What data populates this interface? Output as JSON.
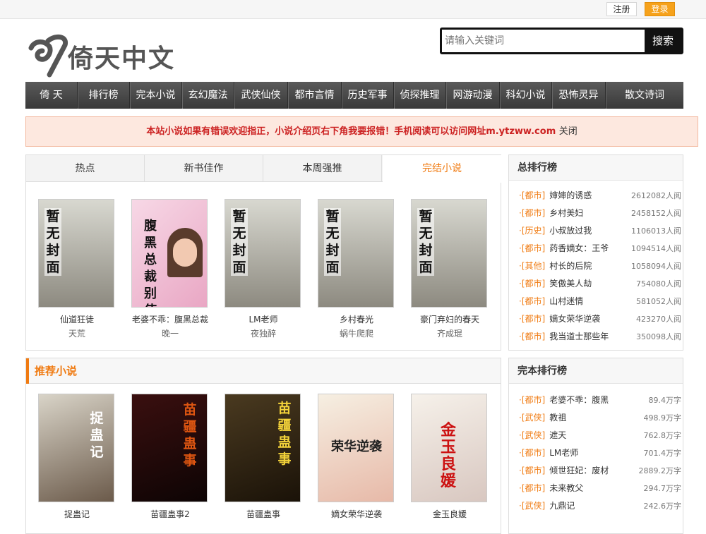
{
  "topbar": {
    "register": "注册",
    "login": "登录"
  },
  "logo": {
    "text": "倚天中文"
  },
  "search": {
    "placeholder": "请输入关键词",
    "button": "搜索"
  },
  "nav": [
    "倚 天",
    "排行榜",
    "完本小说",
    "玄幻魔法",
    "武侠仙侠",
    "都市言情",
    "历史军事",
    "侦探推理",
    "网游动漫",
    "科幻小说",
    "恐怖灵异",
    "散文诗词"
  ],
  "notice": {
    "text": "本站小说如果有错误欢迎指正，小说介绍页右下角我要报错！手机阅读可以访问网址m.ytzww.com",
    "close": "关闭"
  },
  "tabs": [
    "热点",
    "新书佳作",
    "本周强推",
    "完结小说"
  ],
  "featured": [
    {
      "title": "仙道狂徒",
      "author": "天荒",
      "cover": "暂无封面"
    },
    {
      "title": "老婆不乖：腹黑总裁",
      "author": "晚一",
      "cover": "腹黑总裁别使坏"
    },
    {
      "title": "LM老师",
      "author": "夜独醉",
      "cover": "暂无封面"
    },
    {
      "title": "乡村春光",
      "author": "蜗牛爬爬",
      "cover": "暂无封面"
    },
    {
      "title": "豪门弃妇的春天",
      "author": "齐成琨",
      "cover": "暂无封面"
    }
  ],
  "recommend": {
    "heading": "推荐小说",
    "books": [
      {
        "title": "捉蛊记",
        "cover": "捉蛊记"
      },
      {
        "title": "苗疆蛊事2",
        "cover": "苗疆蛊事"
      },
      {
        "title": "苗疆蛊事",
        "cover": "苗疆蛊事"
      },
      {
        "title": "嫡女荣华逆袭",
        "cover": "荣华逆袭"
      },
      {
        "title": "金玉良媛",
        "cover": "金玉良媛"
      }
    ]
  },
  "rank_total": {
    "heading": "总排行榜",
    "rows": [
      {
        "cat": "[都市]",
        "name": "婶婶的诱惑",
        "count": "2612082人阅"
      },
      {
        "cat": "[都市]",
        "name": "乡村美妇",
        "count": "2458152人阅"
      },
      {
        "cat": "[历史]",
        "name": "小叔放过我",
        "count": "1106013人阅"
      },
      {
        "cat": "[都市]",
        "name": "药香嫡女：王爷",
        "count": "1094514人阅"
      },
      {
        "cat": "[其他]",
        "name": "村长的后院",
        "count": "1058094人阅"
      },
      {
        "cat": "[都市]",
        "name": "笑傲美人劫",
        "count": "754080人阅"
      },
      {
        "cat": "[都市]",
        "name": "山村迷情",
        "count": "581052人阅"
      },
      {
        "cat": "[都市]",
        "name": "嫡女荣华逆袭",
        "count": "423270人阅"
      },
      {
        "cat": "[都市]",
        "name": "我当道士那些年",
        "count": "350098人阅"
      }
    ]
  },
  "rank_complete": {
    "heading": "完本排行榜",
    "rows": [
      {
        "cat": "[都市]",
        "name": "老婆不乖：腹黑",
        "count": "89.4万字"
      },
      {
        "cat": "[武侠]",
        "name": "教祖",
        "count": "498.9万字"
      },
      {
        "cat": "[武侠]",
        "name": "遮天",
        "count": "762.8万字"
      },
      {
        "cat": "[都市]",
        "name": "LM老师",
        "count": "701.4万字"
      },
      {
        "cat": "[都市]",
        "name": "倾世狂妃：废材",
        "count": "2889.2万字"
      },
      {
        "cat": "[都市]",
        "name": "未来教父",
        "count": "294.7万字"
      },
      {
        "cat": "[武侠]",
        "name": "九鼎记",
        "count": "242.6万字"
      }
    ]
  },
  "colors": {
    "accent": "#f07b12",
    "notice_text": "#cc2222",
    "nav_bg": "#444444"
  }
}
